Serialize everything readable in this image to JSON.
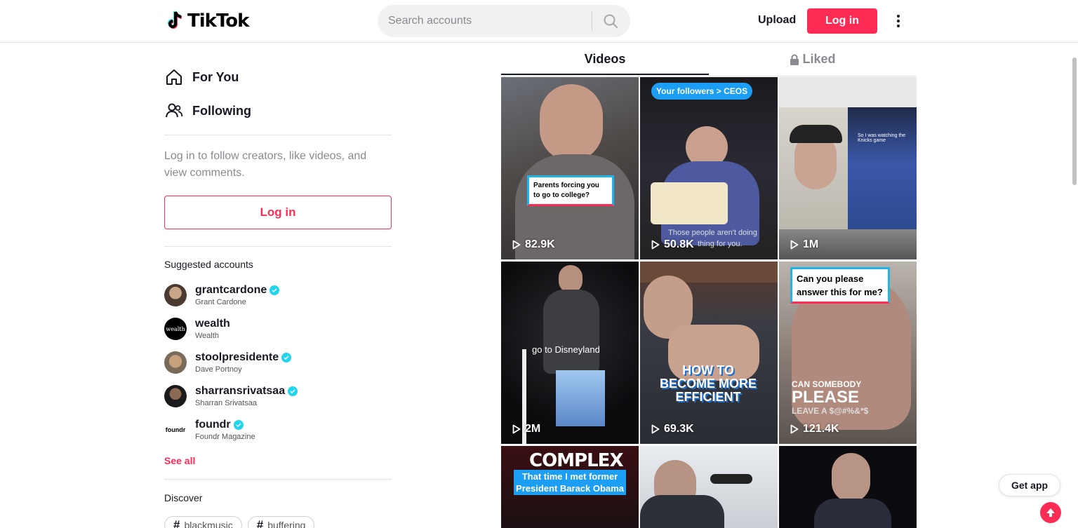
{
  "header": {
    "logo_text": "TikTok",
    "search_placeholder": "Search accounts",
    "upload_label": "Upload",
    "login_label": "Log in"
  },
  "sidebar": {
    "nav": [
      {
        "label": "For You",
        "icon": "home-icon"
      },
      {
        "label": "Following",
        "icon": "users-icon"
      }
    ],
    "login_prompt": "Log in to follow creators, like videos, and view comments.",
    "login_label": "Log in",
    "suggested_title": "Suggested accounts",
    "accounts": [
      {
        "username": "grantcardone",
        "name": "Grant Cardone",
        "verified": true
      },
      {
        "username": "wealth",
        "name": "Wealth",
        "verified": false
      },
      {
        "username": "stoolpresidente",
        "name": "Dave Portnoy",
        "verified": true
      },
      {
        "username": "sharransrivatsaa",
        "name": "Sharran Srivatsaa",
        "verified": true
      },
      {
        "username": "foundr",
        "name": "Foundr Magazine",
        "verified": true
      }
    ],
    "see_all": "See all",
    "discover_title": "Discover",
    "tags": [
      "blackmusic",
      "buffering"
    ]
  },
  "tabs": {
    "videos": "Videos",
    "liked": "Liked"
  },
  "videos": [
    {
      "views": "82.9K",
      "caption": "Parents forcing you to go to college?"
    },
    {
      "views": "50.8K",
      "caption": "Your followers > CEOS",
      "caption2": "Those people aren't doing",
      "caption3": "thing for you."
    },
    {
      "views": "1M",
      "caption": "So I was watching the Knicks game"
    },
    {
      "views": "2M",
      "caption": "go to Disneyland"
    },
    {
      "views": "69.3K",
      "caption": "HOW TO BECOME MORE EFFICIENT"
    },
    {
      "views": "121.4K",
      "caption": "Can you please answer this for me?",
      "caption2": "CAN SOMEBODY",
      "caption3": "PLEASE",
      "caption4": "LEAVE A $@#%&*$"
    },
    {
      "views": "",
      "caption": "That time I met former President Barack Obama",
      "caption2": "COMPLEX"
    },
    {
      "views": ""
    },
    {
      "views": ""
    }
  ],
  "avatar_labels": {
    "wealth": "wealth",
    "foundr": "foundr"
  },
  "get_app": "Get app",
  "colors": {
    "brand": "#fe2c55",
    "verified": "#20d5ec",
    "text": "#161823"
  }
}
